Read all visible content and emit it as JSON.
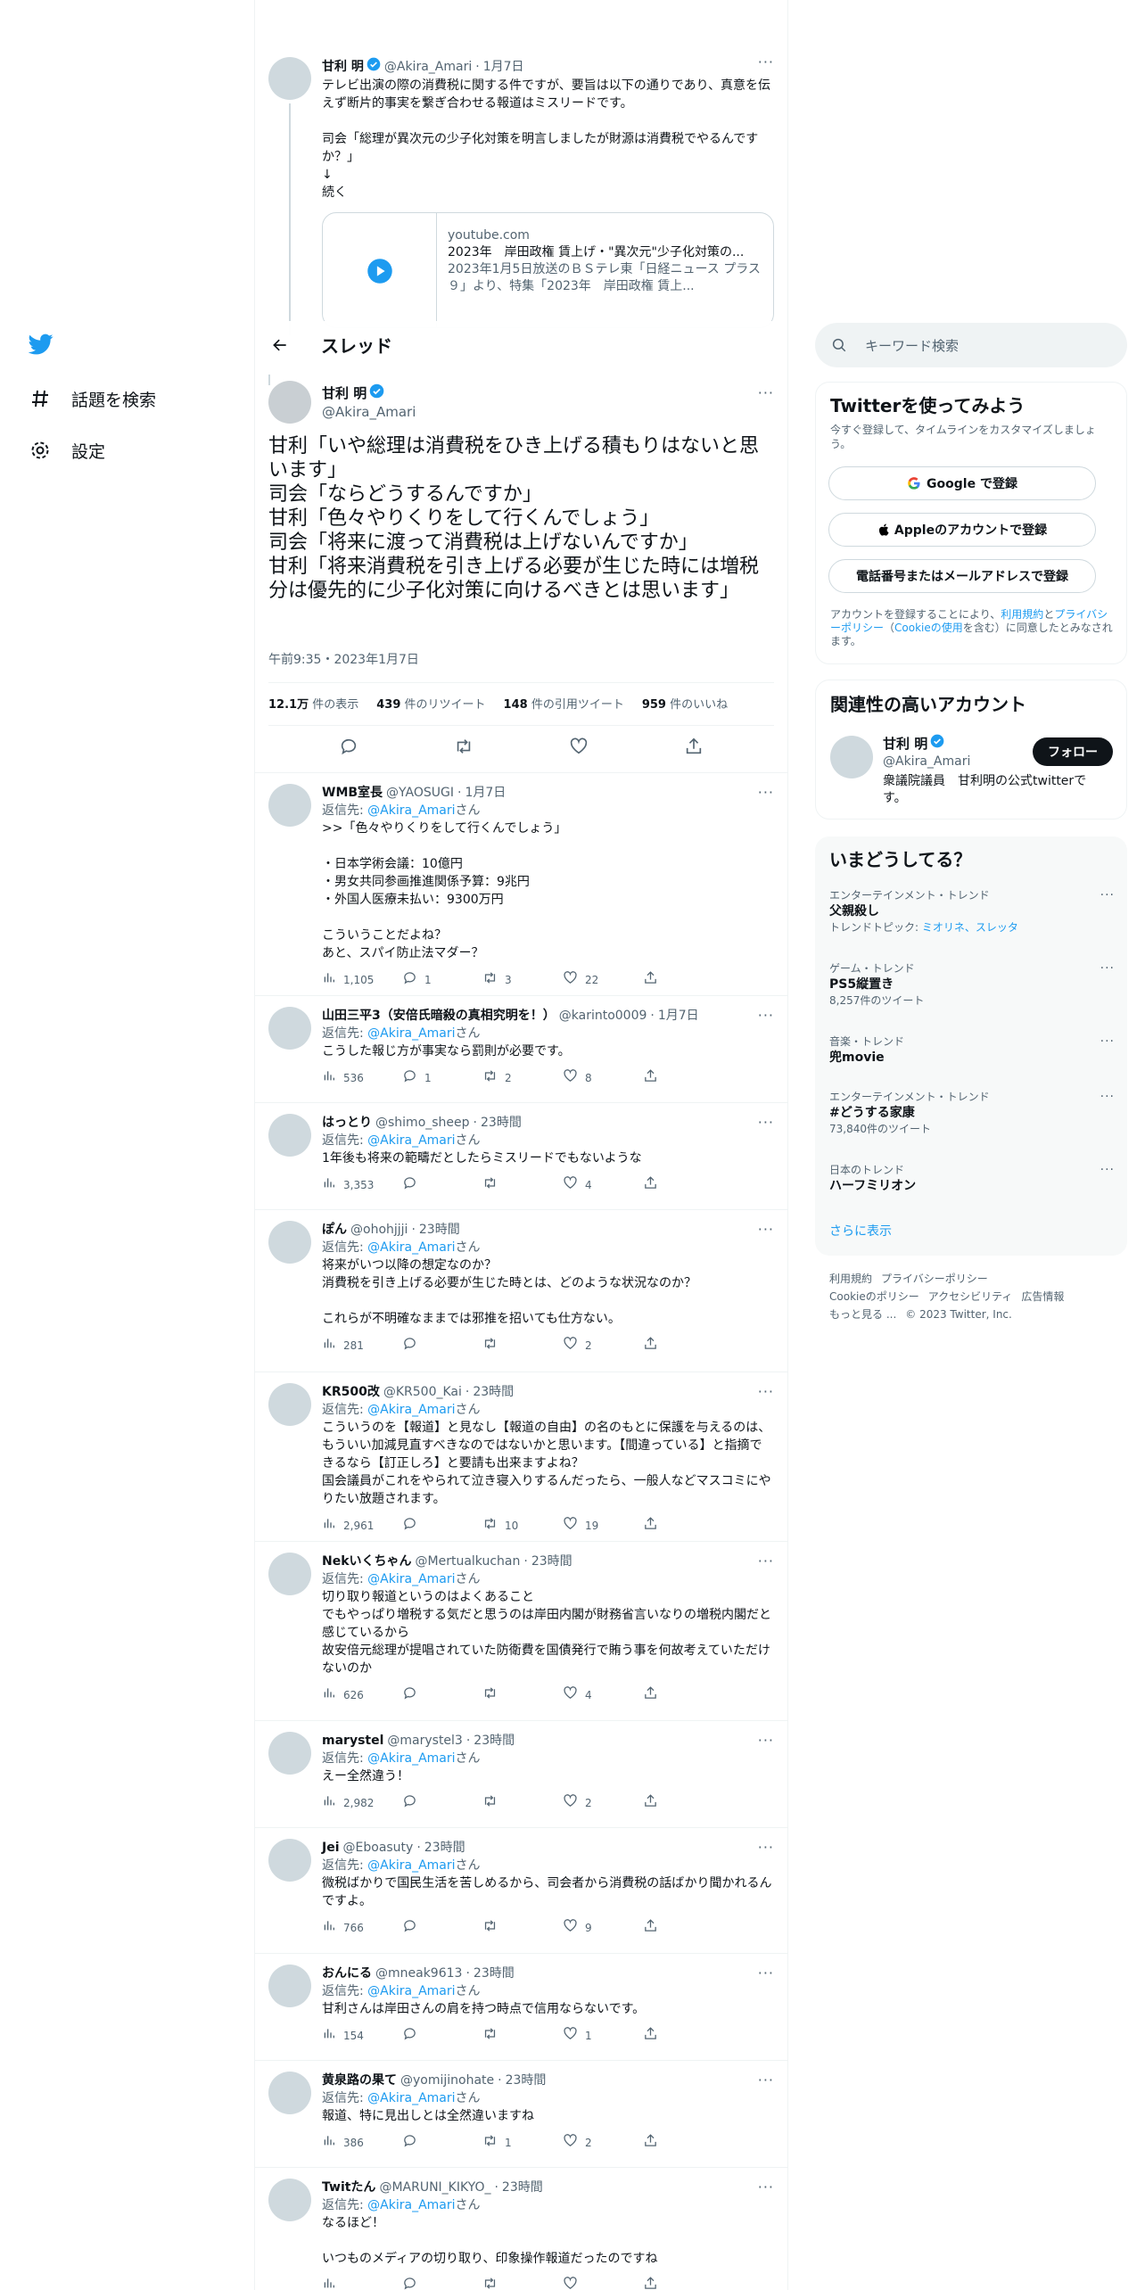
{
  "nav": {
    "explore": "話題を検索",
    "settings": "設定"
  },
  "header": {
    "title": "スレッド"
  },
  "prev_tweet": {
    "name": "甘利 明",
    "handle": "@Akira_Amari",
    "time": "1月7日",
    "text": "テレビ出演の際の消費税に関する件ですが、要旨は以下の通りであり、真意を伝えず断片的事実を繋ぎ合わせる報道はミスリードです。\n\n司会「総理が異次元の少子化対策を明言しましたが財源は消費税でやるんですか？」\n↓\n続く",
    "card": {
      "domain": "youtube.com",
      "title": "2023年　岸田政権 賃上げ・\"異次元\"少子化対策の...",
      "desc": "2023年1月5日放送のＢＳテレ東「日経ニュース プラス９」より、特集「2023年　岸田政権 賃上..."
    }
  },
  "main_tweet": {
    "name": "甘利 明",
    "handle": "@Akira_Amari",
    "text": "甘利「いや総理は消費税をひき上げる積もりはないと思います」\n司会「ならどうするんですか」\n甘利「色々やりくりをして行くんでしょう」\n司会「将来に渡って消費税は上げないんですか」\n甘利「将来消費税を引き上げる必要が生じた時には増税分は優先的に少子化対策に向けるべきとは思います」",
    "time": "午前9:35・2023年1月7日",
    "stats": {
      "views": "12.1万",
      "views_label": "件の表示",
      "rts": "439",
      "rts_label": "件のリツイート",
      "quotes": "148",
      "quotes_label": "件の引用ツイート",
      "likes": "959",
      "likes_label": "件のいいね"
    }
  },
  "reply_prefix": "返信先: ",
  "reply_to": "@Akira_Amari",
  "reply_suffix": "さん",
  "replies": [
    {
      "name": "WMB室長",
      "handle": "@YAOSUGI",
      "time": "1月7日",
      "text": ">>「色々やりくりをして行くんでしょう」\n\n・日本学術会議：10億円\n・男女共同参画推進関係予算：9兆円\n・外国人医療未払い：9300万円\n\nこういうことだよね？\nあと、スパイ防止法マダー？",
      "views": "1,105",
      "replies": "1",
      "rts": "3",
      "likes": "22"
    },
    {
      "name": "山田三平3（安倍氏暗殺の真相究明を！）",
      "handle": "@karinto0009",
      "time": "1月7日",
      "text": "こうした報じ方が事実なら罰則が必要です。",
      "views": "536",
      "replies": "1",
      "rts": "2",
      "likes": "8"
    },
    {
      "name": "はっとり",
      "handle": "@shimo_sheep",
      "time": "23時間",
      "text": "1年後も将来の範疇だとしたらミスリードでもないような",
      "views": "3,353",
      "replies": "",
      "rts": "",
      "likes": "4"
    },
    {
      "name": "ぽん",
      "handle": "@ohohjjji",
      "time": "23時間",
      "text": "将来がいつ以降の想定なのか？\n消費税を引き上げる必要が生じた時とは、どのような状況なのか？\n\nこれらが不明確なままでは邪推を招いても仕方ない。",
      "views": "281",
      "replies": "",
      "rts": "",
      "likes": "2"
    },
    {
      "name": "KR500改",
      "handle": "@KR500_Kai",
      "time": "23時間",
      "text": "こういうのを【報道】と見なし【報道の自由】の名のもとに保護を与えるのは、もういい加減見直すべきなのではないかと思います。【間違っている】と指摘できるなら【訂正しろ】と要請も出来ますよね？\n国会議員がこれをやられて泣き寝入りするんだったら、一般人などマスコミにやりたい放題されます。",
      "views": "2,961",
      "replies": "",
      "rts": "10",
      "likes": "19"
    },
    {
      "name": "Nekいくちゃん",
      "handle": "@Mertualkuchan",
      "time": "23時間",
      "text": "切り取り報道というのはよくあること\nでもやっぱり増税する気だと思うのは岸田内閣が財務省言いなりの増税内閣だと感じているから\n故安倍元総理が提唱されていた防衛費を国債発行で賄う事を何故考えていただけないのか",
      "views": "626",
      "replies": "",
      "rts": "",
      "likes": "4"
    },
    {
      "name": "marystel",
      "handle": "@marystel3",
      "time": "23時間",
      "text": "えー全然違う！",
      "views": "2,982",
      "replies": "",
      "rts": "",
      "likes": "2"
    },
    {
      "name": "Jei",
      "handle": "@Eboasuty",
      "time": "23時間",
      "text": "微税ばかりで国民生活を苦しめるから、司会者から消費税の話ばかり聞かれるんですよ。",
      "views": "766",
      "replies": "",
      "rts": "",
      "likes": "9"
    },
    {
      "name": "おんにる",
      "handle": "@mneak9613",
      "time": "23時間",
      "text": "甘利さんは岸田さんの肩を持つ時点で信用ならないです。",
      "views": "154",
      "replies": "",
      "rts": "",
      "likes": "1"
    },
    {
      "name": "黄泉路の果て",
      "handle": "@yomijinohate",
      "time": "23時間",
      "text": "報道、特に見出しとは全然違いますね",
      "views": "386",
      "replies": "",
      "rts": "1",
      "likes": "2"
    },
    {
      "name": "Twitたん",
      "handle": "@MARUNI_KIKYO_",
      "time": "23時間",
      "text": "なるほど！\n\nいつものメディアの切り取り、印象操作報道だったのですね",
      "views": "",
      "replies": "",
      "rts": "",
      "likes": ""
    }
  ],
  "search": {
    "placeholder": "キーワード検索"
  },
  "signup": {
    "title": "Twitterを使ってみよう",
    "desc": "今すぐ登録して、タイムラインをカスタマイズしましょう。",
    "google": "Google で登録",
    "apple": "Appleのアカウントで登録",
    "phone": "電話番号またはメールアドレスで登録",
    "legal_a": "アカウントを登録することにより、",
    "terms": "利用規約",
    "legal_and": "と",
    "privacy": "プライバシーポリシー",
    "legal_b": "（",
    "cookie": "Cookieの使用",
    "legal_c": "を含む）に同意したとみなされます。"
  },
  "related": {
    "title": "関連性の高いアカウント",
    "name": "甘利 明",
    "handle": "@Akira_Amari",
    "bio": "衆議院議員　甘利明の公式twitterです。",
    "follow": "フォロー"
  },
  "trends": {
    "title": "いまどうしてる？",
    "items": [
      {
        "cat": "エンターテインメント・トレンド",
        "name": "父親殺し",
        "sub_label": "トレンドトピック: ",
        "sub_links": "ミオリネ、スレッタ"
      },
      {
        "cat": "ゲーム・トレンド",
        "name": "PS5縦置き",
        "sub": "8,257件のツイート"
      },
      {
        "cat": "音楽・トレンド",
        "name": "兜movie",
        "sub": ""
      },
      {
        "cat": "エンターテインメント・トレンド",
        "name": "#どうする家康",
        "sub": "73,840件のツイート"
      },
      {
        "cat": "日本のトレンド",
        "name": "ハーフミリオン",
        "sub": ""
      }
    ],
    "more": "さらに表示"
  },
  "footer": {
    "terms": "利用規約",
    "privacy": "プライバシーポリシー",
    "cookie": "Cookieのポリシー",
    "a11y": "アクセシビリティ",
    "ads": "広告情報",
    "more": "もっと見る ...",
    "copy": "© 2023 Twitter, Inc."
  },
  "colors": {
    "accent": "#1d9bf0",
    "text": "#0f1419",
    "muted": "#536471"
  }
}
